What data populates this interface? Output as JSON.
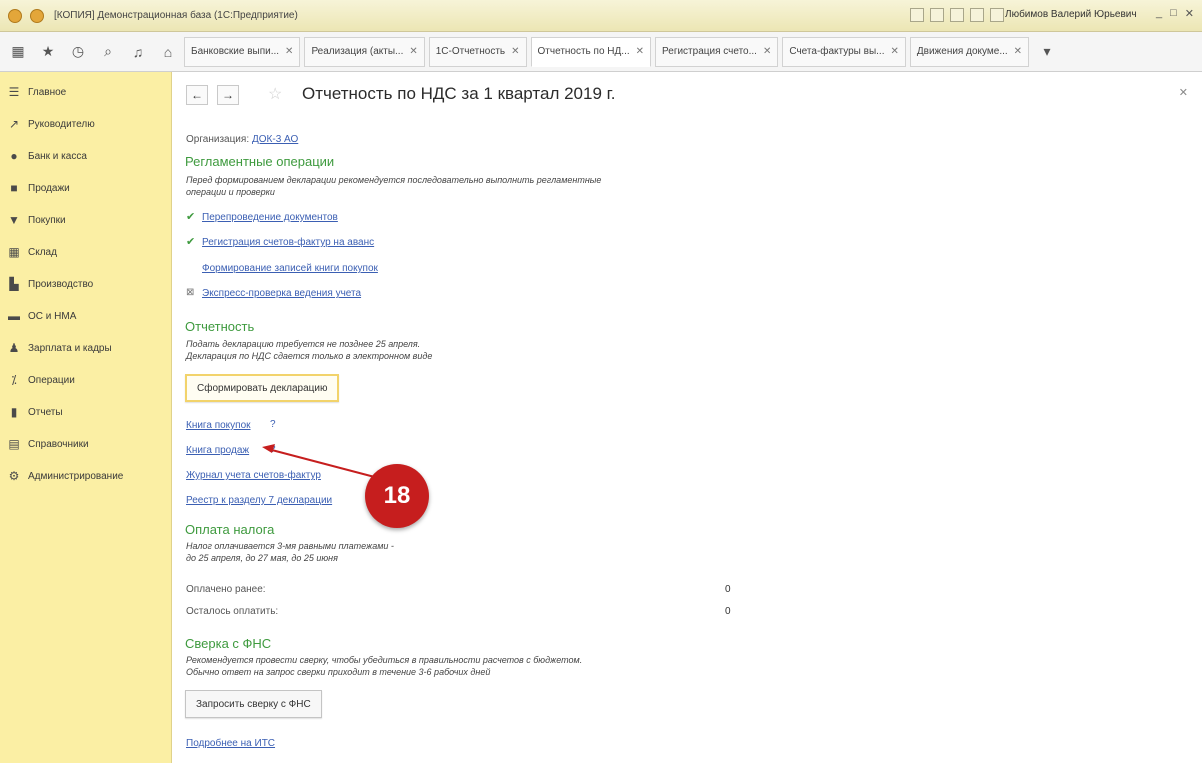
{
  "window": {
    "title": "[КОПИЯ] Демонстрационная база  (1С:Предприятие)",
    "user": "Любимов Валерий Юрьевич"
  },
  "tabs": [
    {
      "label": "Банковские выпи...",
      "active": false
    },
    {
      "label": "Реализация (акты...",
      "active": false
    },
    {
      "label": "1С-Отчетность",
      "active": false
    },
    {
      "label": "Отчетность по НД...",
      "active": true
    },
    {
      "label": "Регистрация счето...",
      "active": false
    },
    {
      "label": "Счета-фактуры вы...",
      "active": false
    },
    {
      "label": "Движения докуме...",
      "active": false
    }
  ],
  "sidebar": {
    "items": [
      {
        "label": "Главное",
        "icon": "menu-icon"
      },
      {
        "label": "Руководителю",
        "icon": "trend-icon"
      },
      {
        "label": "Банк и касса",
        "icon": "coin-icon"
      },
      {
        "label": "Продажи",
        "icon": "bag-icon"
      },
      {
        "label": "Покупки",
        "icon": "cart-icon"
      },
      {
        "label": "Склад",
        "icon": "warehouse-icon"
      },
      {
        "label": "Производство",
        "icon": "factory-icon"
      },
      {
        "label": "ОС и НМА",
        "icon": "truck-icon"
      },
      {
        "label": "Зарплата и кадры",
        "icon": "person-icon"
      },
      {
        "label": "Операции",
        "icon": "operations-icon"
      },
      {
        "label": "Отчеты",
        "icon": "chart-icon"
      },
      {
        "label": "Справочники",
        "icon": "book-icon"
      },
      {
        "label": "Администрирование",
        "icon": "gear-icon"
      }
    ]
  },
  "main": {
    "title": "Отчетность по НДС за 1 квартал 2019 г.",
    "org_label": "Организация:",
    "org_value": "ДОК-3 АО",
    "reg_ops": {
      "heading": "Регламентные операции",
      "note1": "Перед формированием декларации рекомендуется последовательно выполнить регламентные",
      "note2": "операции и проверки",
      "links": [
        "Перепроведение документов",
        "Регистрация счетов-фактур на аванс",
        "Формирование записей книги покупок",
        "Экспресс-проверка ведения учета"
      ]
    },
    "reporting": {
      "heading": "Отчетность",
      "note1": "Подать декларацию требуется не позднее 25 апреля.",
      "note2": "Декларация по НДС сдается только в электронном виде",
      "button": "Сформировать декларацию",
      "links": [
        "Книга покупок",
        "Книга продаж",
        "Журнал учета счетов-фактур",
        "Реестр к разделу 7 декларации"
      ],
      "help_mark": "?"
    },
    "tax_payment": {
      "heading": "Оплата налога",
      "note1": "Налог оплачивается 3-мя равными платежами -",
      "note2": "до 25 апреля, до 27 мая, до 25 июня",
      "paid_label": "Оплачено ранее:",
      "paid_value": "0",
      "remaining_label": "Осталось оплатить:",
      "remaining_value": "0"
    },
    "fns": {
      "heading": "Сверка с ФНС",
      "note1": "Рекомендуется провести сверку, чтобы убедиться в правильности расчетов с бюджетом.",
      "note2": "Обычно ответ на запрос сверки приходит в течение 3-6 рабочих дней",
      "button": "Запросить сверку с ФНС",
      "more_link": "Подробнее на ИТС"
    }
  },
  "annotation": {
    "number": "18"
  },
  "colors": {
    "sidebar_bg": "#fbefa4",
    "heading_green": "#3e9a3e",
    "link_blue": "#3b5fb3",
    "badge_red": "#c61e1e"
  }
}
